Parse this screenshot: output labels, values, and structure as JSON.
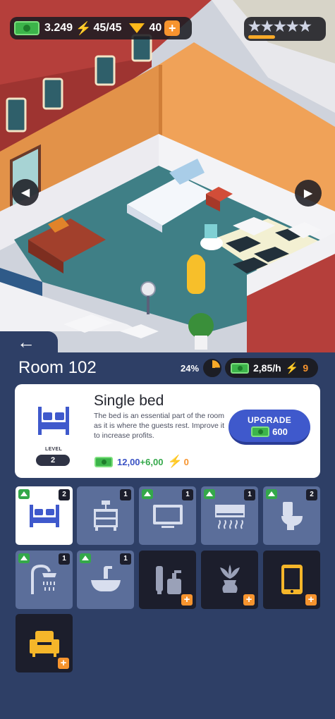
{
  "hud": {
    "cash": "3.249",
    "energy": "45/45",
    "gems": "40",
    "plus_symbol": "+",
    "rating_stars": "★★★★★",
    "rating_progress": 0.45
  },
  "nav": {
    "left_arrow": "◀",
    "right_arrow": "▶",
    "back_arrow": "←"
  },
  "room": {
    "title": "Room 102",
    "completion": "24%",
    "completion_fraction": 0.24,
    "income_rate": "2,85/h",
    "energy_cost": "9"
  },
  "item_detail": {
    "title": "Single bed",
    "description": "The bed is an essential part of the room as it is where the guests rest. Improve it to increase profits.",
    "level_label": "LEVEL",
    "level": "2",
    "income_value": "12,00",
    "income_bonus": "+6,00",
    "energy_value": "0",
    "upgrade_label": "UPGRADE",
    "upgrade_cost": "600"
  },
  "items": [
    {
      "name": "bed",
      "icon": "bed-icon",
      "count": "2",
      "state": "selected"
    },
    {
      "name": "nightstand",
      "icon": "nightstand-icon",
      "count": "1",
      "state": "owned"
    },
    {
      "name": "tv",
      "icon": "tv-icon",
      "count": "1",
      "state": "owned"
    },
    {
      "name": "air-conditioner",
      "icon": "air-conditioner-icon",
      "count": "1",
      "state": "owned"
    },
    {
      "name": "toilet",
      "icon": "toilet-icon",
      "count": "2",
      "state": "owned"
    },
    {
      "name": "shower",
      "icon": "shower-icon",
      "count": "1",
      "state": "owned"
    },
    {
      "name": "sink",
      "icon": "sink-icon",
      "count": "1",
      "state": "owned"
    },
    {
      "name": "toiletries",
      "icon": "toiletries-icon",
      "state": "locked"
    },
    {
      "name": "plant",
      "icon": "plant-vase-icon",
      "state": "locked"
    },
    {
      "name": "tablet",
      "icon": "tablet-icon",
      "state": "locked"
    },
    {
      "name": "armchair",
      "icon": "armchair-icon",
      "state": "locked"
    }
  ],
  "colors": {
    "panel_bg": "#2e3f66",
    "tile_owned": "#5b6e9a",
    "tile_locked": "#1c1e2c",
    "accent_orange": "#f7942e",
    "accent_blue": "#3f59cc",
    "accent_green": "#34a84a"
  }
}
